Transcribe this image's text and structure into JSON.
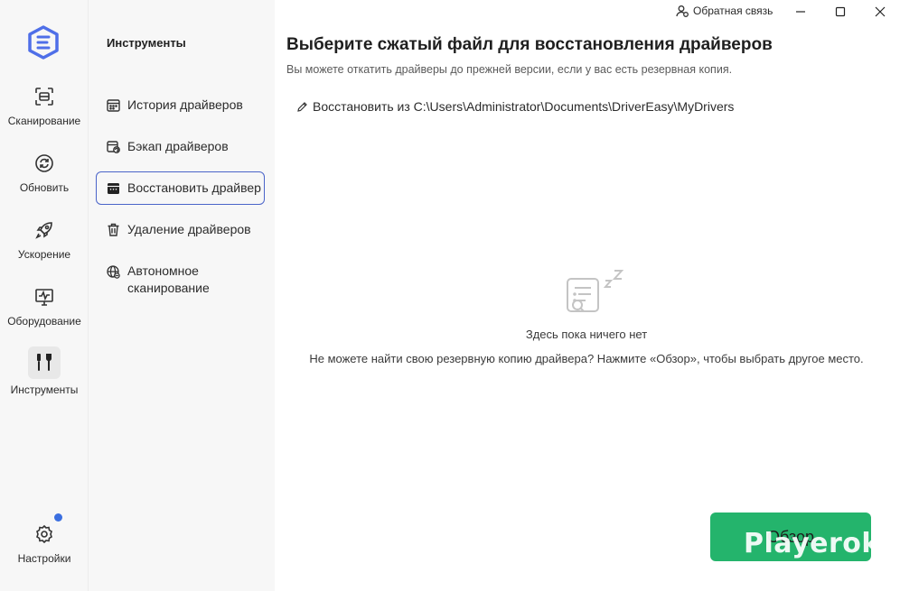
{
  "nav": {
    "items": [
      {
        "label": "Сканирование",
        "icon": "scan-icon"
      },
      {
        "label": "Обновить",
        "icon": "refresh-icon"
      },
      {
        "label": "Ускорение",
        "icon": "rocket-icon"
      },
      {
        "label": "Оборудование",
        "icon": "monitor-pulse-icon"
      },
      {
        "label": "Инструменты",
        "icon": "tools-icon",
        "active": true
      },
      {
        "label": "Настройки",
        "icon": "gear-icon"
      }
    ]
  },
  "tools": {
    "title": "Инструменты",
    "items": [
      {
        "label": "История драйверов",
        "icon": "calendar-icon"
      },
      {
        "label": "Бэкап драйверов",
        "icon": "backup-icon"
      },
      {
        "label": "Восстановить драйвер",
        "icon": "restore-icon",
        "active": true
      },
      {
        "label": "Удаление драйверов",
        "icon": "trash-icon"
      },
      {
        "label_line1": "Автономное",
        "label_line2": "сканирование",
        "icon": "globe-icon"
      }
    ]
  },
  "topbar": {
    "feedback_label": "Обратная связь"
  },
  "main": {
    "title": "Выберите сжатый файл для восстановления драйверов",
    "subtitle": "Вы можете откатить драйверы до прежней версии, если у вас есть резервная копия.",
    "restore_path": "Восстановить из C:\\Users\\Administrator\\Documents\\DriverEasy\\MyDrivers",
    "empty_text": "Здесь пока ничего нет",
    "empty_hint": "Не можете найти свою резервную копию драйвера? Нажмите «Обзор», чтобы выбрать другое место.",
    "browse_label": "Обзор"
  },
  "watermark": "Playerok",
  "colors": {
    "accent": "#4a64c9",
    "button": "#24b46c",
    "notification": "#3b6fe0"
  }
}
